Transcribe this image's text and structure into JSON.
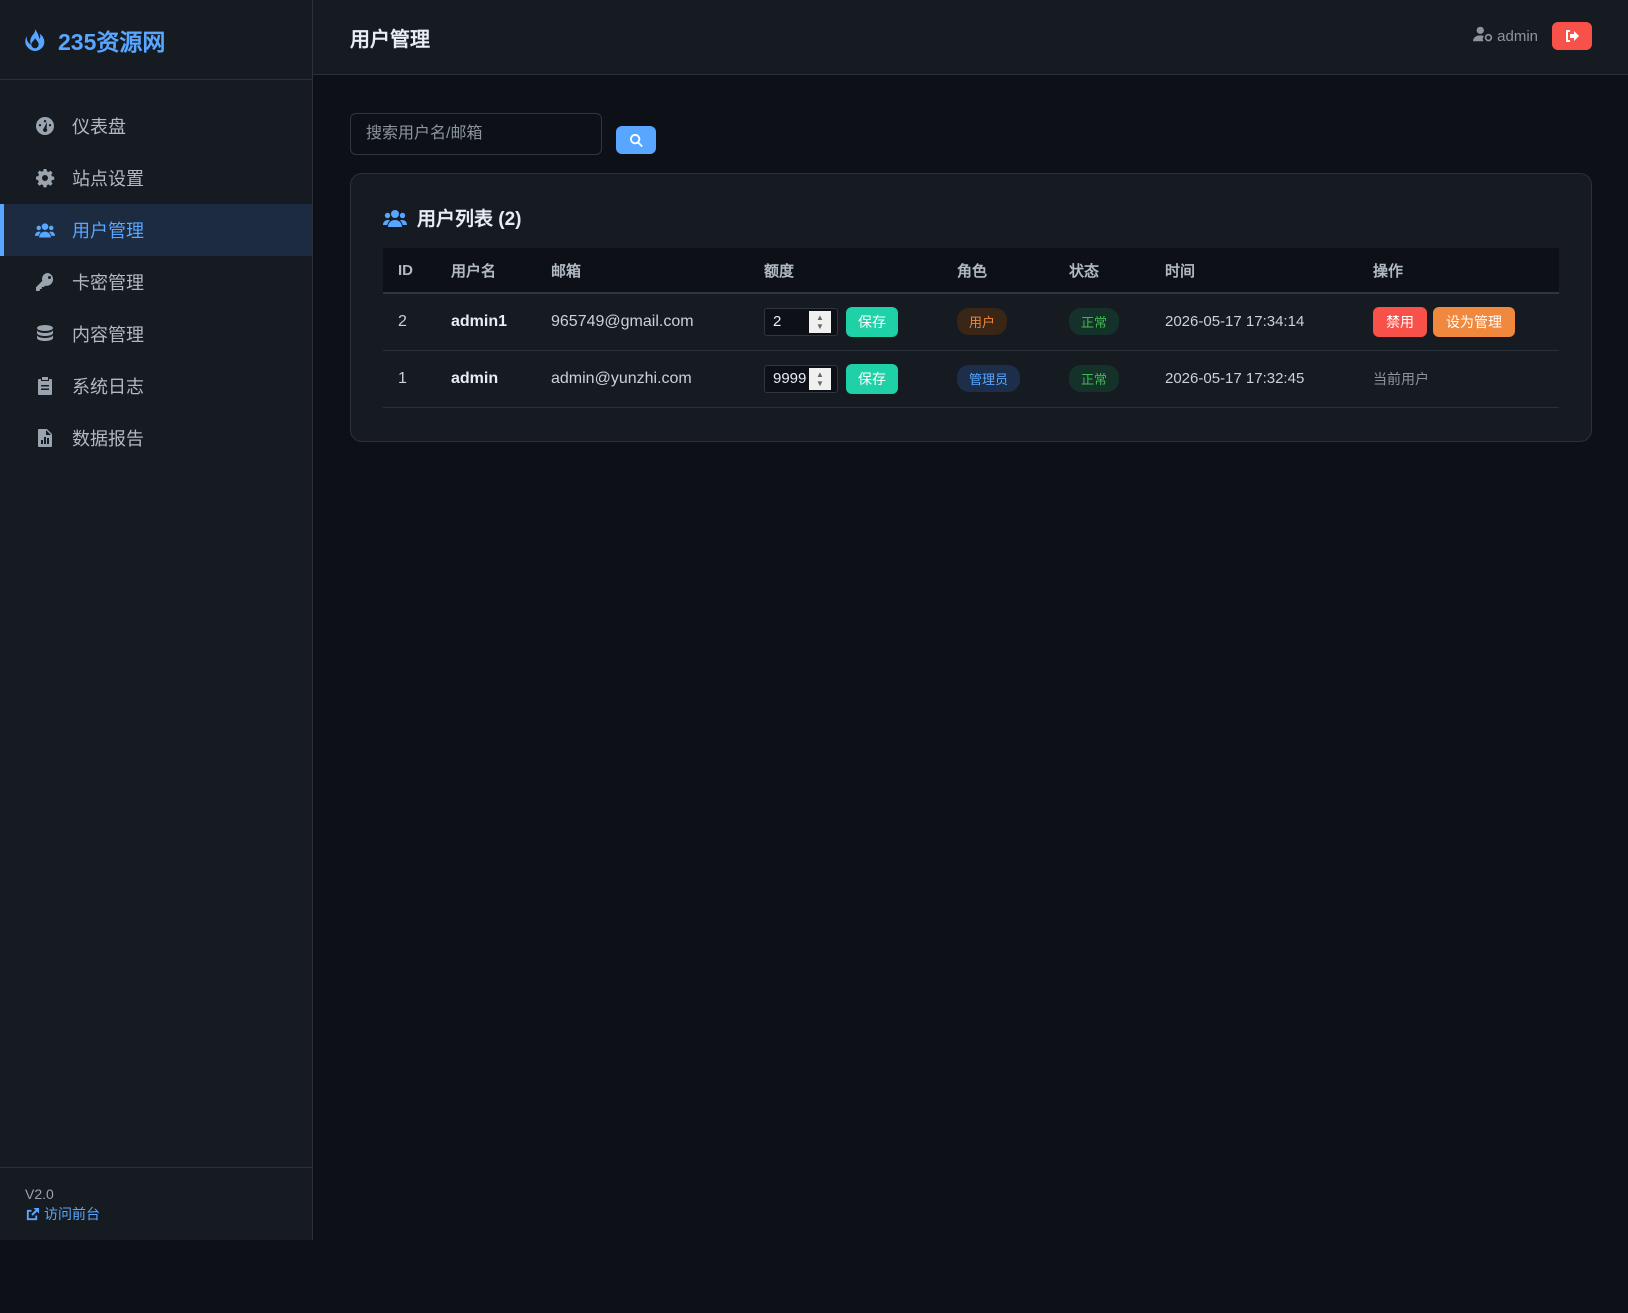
{
  "brand": {
    "name": "235资源网",
    "icon": "fire-icon",
    "color": "#58a6ff"
  },
  "sidebar": {
    "items": [
      {
        "label": "仪表盘",
        "icon": "dashboard-icon"
      },
      {
        "label": "站点设置",
        "icon": "gear-icon"
      },
      {
        "label": "用户管理",
        "icon": "users-icon",
        "active": true
      },
      {
        "label": "卡密管理",
        "icon": "key-icon"
      },
      {
        "label": "内容管理",
        "icon": "database-icon"
      },
      {
        "label": "系统日志",
        "icon": "clipboard-icon"
      },
      {
        "label": "数据报告",
        "icon": "file-chart-icon"
      }
    ],
    "version": "V2.0",
    "visit_label": "访问前台"
  },
  "header": {
    "title": "用户管理",
    "user": "admin",
    "logout_icon": "logout-icon"
  },
  "search": {
    "placeholder": "搜索用户名/邮箱",
    "value": ""
  },
  "user_list": {
    "title": "用户列表 (2)",
    "columns": [
      "ID",
      "用户名",
      "邮箱",
      "额度",
      "角色",
      "状态",
      "时间",
      "操作"
    ],
    "rows": [
      {
        "id": "2",
        "username": "admin1",
        "email": "965749@gmail.com",
        "quota": "2",
        "save_label": "保存",
        "role": "用户",
        "status": "正常",
        "time": "2026-05-17 17:34:14",
        "action_ban": "禁用",
        "action_admin": "设为管理"
      },
      {
        "id": "1",
        "username": "admin",
        "email": "admin@yunzhi.com",
        "quota": "9999",
        "save_label": "保存",
        "role": "管理员",
        "status": "正常",
        "time": "2026-05-17 17:32:45",
        "action_note": "当前用户"
      }
    ]
  },
  "colors": {
    "accent": "#58a6ff",
    "save": "#1fd1a6",
    "danger": "#f85149",
    "warning": "#f0883e"
  }
}
